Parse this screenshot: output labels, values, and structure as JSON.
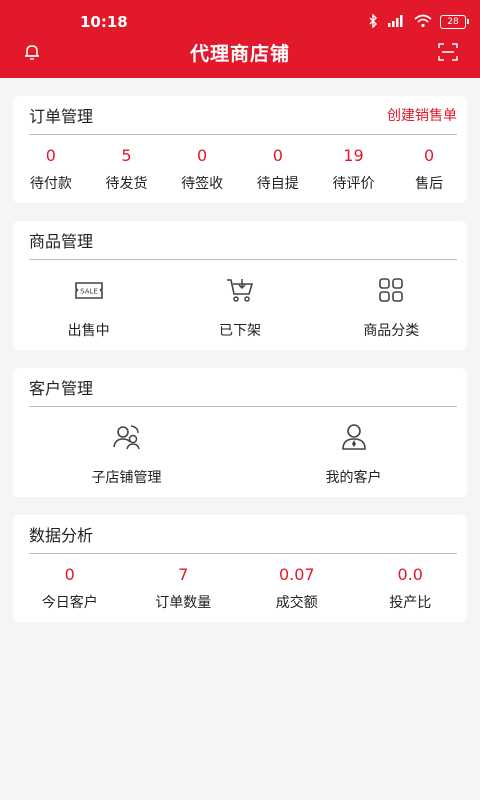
{
  "status_bar": {
    "time": "10:18",
    "battery": "28"
  },
  "header": {
    "title": "代理商店铺"
  },
  "orders": {
    "title": "订单管理",
    "action": "创建销售单",
    "stats": [
      {
        "value": "0",
        "label": "待付款"
      },
      {
        "value": "5",
        "label": "待发货"
      },
      {
        "value": "0",
        "label": "待签收"
      },
      {
        "value": "0",
        "label": "待自提"
      },
      {
        "value": "19",
        "label": "待评价"
      },
      {
        "value": "0",
        "label": "售后"
      }
    ]
  },
  "products": {
    "title": "商品管理",
    "items": [
      {
        "label": "出售中",
        "icon": "sale-tag-icon"
      },
      {
        "label": "已下架",
        "icon": "cart-icon"
      },
      {
        "label": "商品分类",
        "icon": "category-grid-icon"
      }
    ]
  },
  "customers": {
    "title": "客户管理",
    "items": [
      {
        "label": "子店铺管理",
        "icon": "group-users-icon"
      },
      {
        "label": "我的客户",
        "icon": "user-icon"
      }
    ]
  },
  "analytics": {
    "title": "数据分析",
    "stats": [
      {
        "value": "0",
        "label": "今日客户"
      },
      {
        "value": "7",
        "label": "订单数量"
      },
      {
        "value": "0.07",
        "label": "成交额"
      },
      {
        "value": "0.0",
        "label": "投产比"
      }
    ]
  }
}
